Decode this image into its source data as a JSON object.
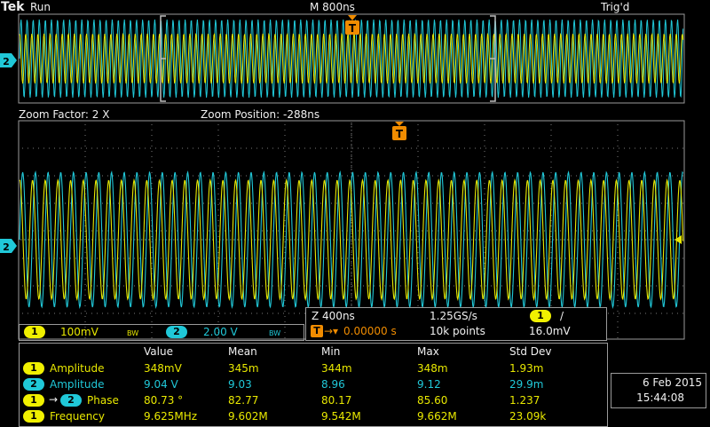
{
  "status_bar": {
    "brand": "Tek",
    "run_state": "Run",
    "timebase": "M 800ns",
    "trigger_state": "Trig'd"
  },
  "colors": {
    "ch1": "#e8e800",
    "ch2": "#20c8d8",
    "grid": "#7a7a7a",
    "border": "#9a9a9a",
    "trigger_marker": "#f08c00"
  },
  "icons": {
    "trigger_marker": "T-in-orange-pentagon",
    "ch2_ground_marker": "2-in-cyan-arrow",
    "ch1_trigger_level": "yellow-left-arrow"
  },
  "zoom": {
    "factor_label": "Zoom Factor: 2 X",
    "position_label": "Zoom Position: -288ns"
  },
  "channel_markers": {
    "top_label": "2",
    "bottom_label": "2"
  },
  "channel_settings": {
    "ch1_num": "1",
    "ch1_scale": "100mV",
    "ch1_bw": "BW",
    "ch2_num": "2",
    "ch2_scale": "2.00 V",
    "ch2_bw": "BW"
  },
  "acquisition": {
    "zoom_scale": "Z 400ns",
    "sample_rate": "1.25GS/s",
    "trigger_source": "1",
    "trigger_slope": "/",
    "trigger_position": "0.00000 s",
    "record_length": "10k points",
    "trigger_level": "16.0mV"
  },
  "measurements": {
    "headers": [
      "Value",
      "Mean",
      "Min",
      "Max",
      "Std Dev"
    ],
    "rows": [
      {
        "src": "1",
        "src2": "",
        "name": "Amplitude",
        "value": "348mV",
        "mean": "345m",
        "min": "344m",
        "max": "348m",
        "std": "1.93m",
        "color": "yellow"
      },
      {
        "src": "2",
        "src2": "",
        "name": "Amplitude",
        "value": "9.04 V",
        "mean": "9.03",
        "min": "8.96",
        "max": "9.12",
        "std": "29.9m",
        "color": "cyan"
      },
      {
        "src": "1",
        "src2": "2",
        "name": "Phase",
        "value": "80.73 °",
        "mean": "82.77",
        "min": "80.17",
        "max": "85.60",
        "std": "1.237",
        "color": "yellow"
      },
      {
        "src": "1",
        "src2": "",
        "name": "Frequency",
        "value": "9.625MHz",
        "mean": "9.602M",
        "min": "9.542M",
        "max": "9.662M",
        "std": "23.09k",
        "color": "yellow"
      }
    ]
  },
  "datetime": {
    "date": "6 Feb  2015",
    "time": "15:44:08"
  },
  "waveform": {
    "frequency_mhz": 9.625,
    "ch1_amplitude_mv": 348,
    "ch2_amplitude_v": 9.04,
    "phase_deg": 80.73
  }
}
